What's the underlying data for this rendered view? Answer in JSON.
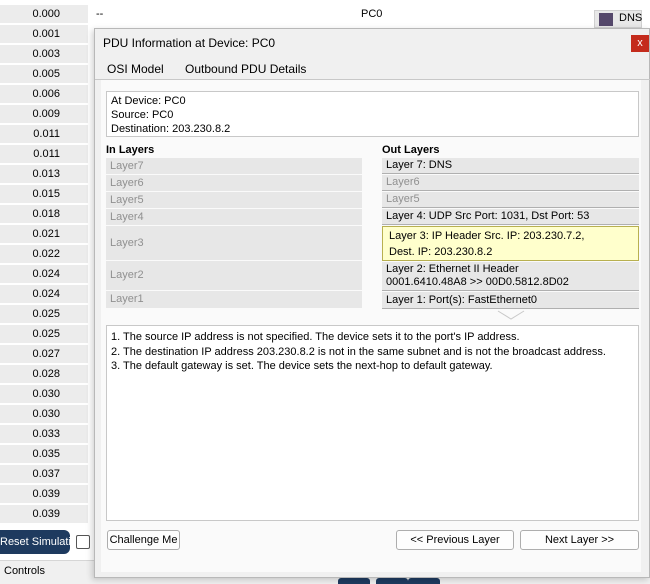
{
  "events": [
    {
      "time": "0.000",
      "last_device": "--",
      "at_device": "PC0",
      "type": "DNS",
      "type_color": "#55486b"
    },
    {
      "time": "0.001"
    },
    {
      "time": "0.003"
    },
    {
      "time": "0.005"
    },
    {
      "time": "0.006"
    },
    {
      "time": "0.009"
    },
    {
      "time": "0.011"
    },
    {
      "time": "0.011"
    },
    {
      "time": "0.013"
    },
    {
      "time": "0.015"
    },
    {
      "time": "0.018"
    },
    {
      "time": "0.021"
    },
    {
      "time": "0.022"
    },
    {
      "time": "0.024"
    },
    {
      "time": "0.024"
    },
    {
      "time": "0.025"
    },
    {
      "time": "0.025"
    },
    {
      "time": "0.027"
    },
    {
      "time": "0.028"
    },
    {
      "time": "0.030"
    },
    {
      "time": "0.030"
    },
    {
      "time": "0.033"
    },
    {
      "time": "0.035"
    },
    {
      "time": "0.037"
    },
    {
      "time": "0.039"
    },
    {
      "time": "0.039"
    }
  ],
  "controls": {
    "reset_label": "Reset Simulation",
    "controls_label": "Controls"
  },
  "dialog": {
    "title": "PDU Information at Device: PC0",
    "close": "x",
    "tabs": [
      {
        "label": "OSI Model",
        "active": true
      },
      {
        "label": "Outbound PDU Details",
        "active": false
      }
    ],
    "info": {
      "device": "At Device: PC0",
      "source": "Source: PC0",
      "destination": "Destination: 203.230.8.2"
    },
    "in_layers_label": "In Layers",
    "out_layers_label": "Out Layers",
    "in_layers": [
      "Layer7",
      "Layer6",
      "Layer5",
      "Layer4",
      "Layer3",
      "Layer2",
      "Layer1"
    ],
    "out_layers": [
      {
        "line1": "Layer 7: DNS",
        "active": true
      },
      {
        "line1": "Layer6",
        "active": false
      },
      {
        "line1": "Layer5",
        "active": false
      },
      {
        "line1": "Layer 4: UDP Src Port: 1031, Dst Port: 53",
        "active": true
      },
      {
        "line1": "Layer 3: IP Header Src. IP: 203.230.7.2,",
        "line2": "Dest. IP: 203.230.8.2",
        "active": true,
        "selected": true
      },
      {
        "line1": "Layer 2: Ethernet II Header",
        "line2": "0001.6410.48A8 >> 00D0.5812.8D02",
        "active": true
      },
      {
        "line1": "Layer 1: Port(s): FastEthernet0",
        "active": true
      }
    ],
    "messages": [
      "1. The source IP address is not specified. The device sets it to the port's IP address.",
      "2. The destination IP address 203.230.8.2 is not in the same subnet and is not the broadcast address.",
      "3. The default gateway is set. The device sets the next-hop to default gateway."
    ],
    "buttons": {
      "challenge": "Challenge Me",
      "previous": "<< Previous Layer",
      "next": "Next Layer >>"
    }
  }
}
